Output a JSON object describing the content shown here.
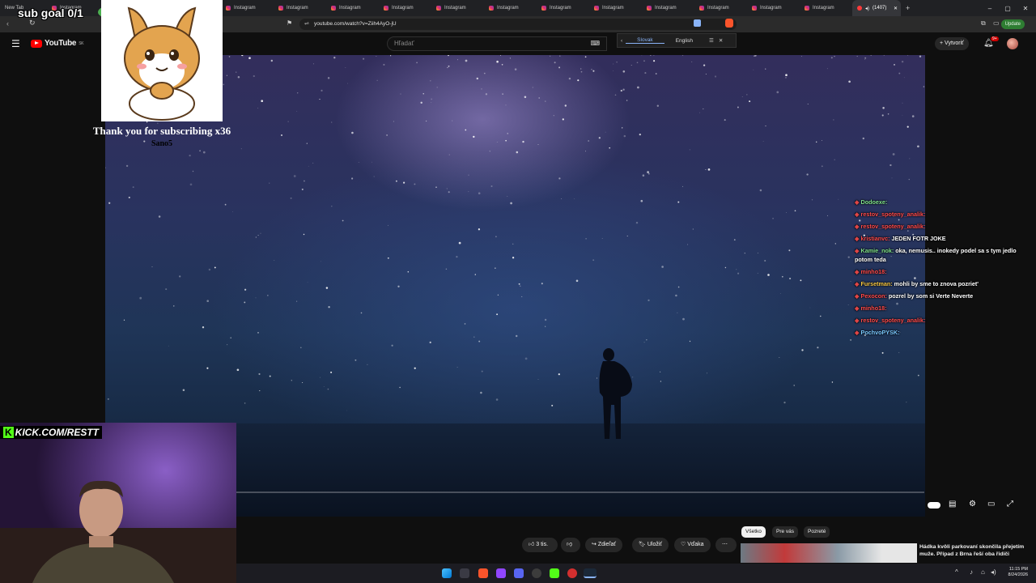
{
  "browser": {
    "tabs": [
      {
        "label": "New Tab"
      },
      {
        "label": "Instagram"
      },
      {
        "label": "Instagram"
      },
      {
        "label": "Instagram"
      },
      {
        "label": "Instagram"
      },
      {
        "label": "Instagram"
      },
      {
        "label": "Instagram"
      },
      {
        "label": "Instagram"
      },
      {
        "label": "Instagram"
      },
      {
        "label": "Instagram"
      },
      {
        "label": "Instagram"
      },
      {
        "label": "Instagram"
      },
      {
        "label": "Instagram"
      },
      {
        "label": "Instagram"
      },
      {
        "label": "Instagram"
      },
      {
        "label": "Instagram"
      },
      {
        "label": "Instagram"
      }
    ],
    "active_tab": "(1407)",
    "url": "youtube.com/watch?v=Ziih4AyO-jU",
    "update_label": "Update"
  },
  "youtube": {
    "logo_text": "YouTube",
    "region": "SK",
    "search_placeholder": "Hľadať",
    "create_label": "Vytvoriť",
    "notification_count": "9+"
  },
  "translate": {
    "source_lang": "Slovak",
    "target_lang": "English"
  },
  "alert": {
    "sub_goal": "sub goal 0/1",
    "message": "Thank you for subscribing x36",
    "username": "Sano5"
  },
  "kick": {
    "label": "KICK.COM/RESTT"
  },
  "chat": [
    {
      "user": "Dodoexe:",
      "message": "",
      "color": "g"
    },
    {
      "user": "restov_spoteny_analik:",
      "message": "",
      "color": "r"
    },
    {
      "user": "restov_spoteny_analik:",
      "message": "",
      "color": "r"
    },
    {
      "user": "kristianvc:",
      "message": "JEDEN FOTR JOKE",
      "color": "r"
    },
    {
      "user": "Kamie_nok:",
      "message": "oka, nemusis.. inokedy podel sa s tym jedlo potom teda",
      "color": "g"
    },
    {
      "user": "minho18:",
      "message": "",
      "color": "r"
    },
    {
      "user": "Fursetman:",
      "message": "mohli by sme to znova pozriet'",
      "color": "y"
    },
    {
      "user": "Pexocon:",
      "message": "pozrel by som si Verte Neverte",
      "color": "r"
    },
    {
      "user": "minho18:",
      "message": "",
      "color": "r"
    },
    {
      "user": "restov_spoteny_analik:",
      "message": "",
      "color": "r"
    },
    {
      "user": "PochvoPYSK:",
      "message": "",
      "color": "c"
    }
  ],
  "actions": {
    "like_count": "3 tis.",
    "share": "Zdieľať",
    "save": "Uložiť",
    "thanks": "Vďaka"
  },
  "chips": [
    "Všetko",
    "Pre vás",
    "Pozreté"
  ],
  "recommendation": {
    "title": "Hádka kvôli parkovaní skončila přejetím muže. Případ z Brna řeší oba řidiči"
  },
  "clock": {
    "time": "11:15 PM",
    "date": "8/24/2026"
  },
  "colors": {
    "accent_red": "#ff0000",
    "kick_green": "#53fc18",
    "update_green": "#2e7d32"
  }
}
